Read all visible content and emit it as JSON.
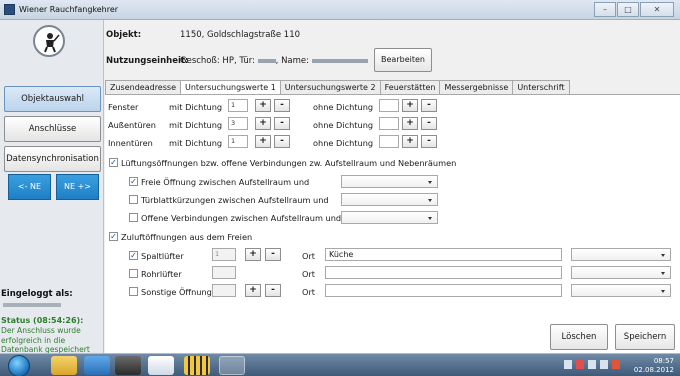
{
  "window": {
    "title": "Wiener Rauchfangkehrer"
  },
  "header": {
    "objekt_label": "Objekt:",
    "objekt_value": "1150, Goldschlagstraße 110",
    "nutzung_label": "Nutzungseinheit:",
    "nutzung_geschoss": "Geschoß: HP, Tür:",
    "nutzung_name": ", Name:",
    "edit_button": "Bearbeiten"
  },
  "sidebar": {
    "buttons": [
      "Objektauswahl",
      "Anschlüsse",
      "Datensynchronisation"
    ],
    "nav_prev": "<- NE",
    "nav_next": "NE +>",
    "logged_in_label": "Eingeloggt als:",
    "status_title": "Status (08:54:26):",
    "status_message": "Der Anschluss wurde erfolgreich in die Datenbank gespeichert"
  },
  "tabs": [
    "Zusendeadresse",
    "Untersuchungswerte 1",
    "Untersuchungswerte 2",
    "Feuerstätten",
    "Messergebnisse",
    "Unterschrift"
  ],
  "active_tab": "Untersuchungswerte 1",
  "rows": [
    {
      "label": "Fenster",
      "mit": "mit Dichtung",
      "mit_value": "1",
      "ohne": "ohne Dichtung",
      "ohne_value": ""
    },
    {
      "label": "Außentüren",
      "mit": "mit Dichtung",
      "mit_value": "3",
      "ohne": "ohne Dichtung",
      "ohne_value": ""
    },
    {
      "label": "Innentüren",
      "mit": "mit Dichtung",
      "mit_value": "1",
      "ohne": "ohne Dichtung",
      "ohne_value": ""
    }
  ],
  "stepper": {
    "plus": "+",
    "minus": "-"
  },
  "section1": {
    "label": "Lüftungsöffnungen bzw. offene Verbindungen zw. Aufstellraum und Nebenräumen",
    "checked": true,
    "items": [
      {
        "label": "Freie Öffnung zwischen Aufstellraum und",
        "checked": true
      },
      {
        "label": "Türblattkürzungen zwischen Aufstellraum und",
        "checked": false
      },
      {
        "label": "Offene Verbindungen zwischen Aufstellraum und",
        "checked": false
      }
    ]
  },
  "section2": {
    "label": "Zuluftöffnungen aus dem Freien",
    "checked": true,
    "ort_label": "Ort",
    "items": [
      {
        "label": "Spaltlüfter",
        "checked": true,
        "count": "1",
        "ort": "Küche"
      },
      {
        "label": "Rohrlüfter",
        "checked": false,
        "count": "",
        "ort": ""
      },
      {
        "label": "Sonstige Öffnung",
        "checked": false,
        "count": "",
        "ort": ""
      }
    ]
  },
  "footer": {
    "delete_button": "Löschen",
    "save_button": "Speichern"
  },
  "taskbar": {
    "time": "08:57",
    "date": "02.08.2012"
  },
  "colors": {
    "nav_button": "#1f7fc6",
    "status_text": "#2e7d2e",
    "active_tab_bg": "#ffffff"
  },
  "icons": [
    "chimney-sweep-logo-icon",
    "start-orb-icon",
    "explorer-icon",
    "outlook-icon",
    "terminal-icon",
    "app-icon",
    "calculator-icon",
    "chimney-sweep-icon"
  ]
}
